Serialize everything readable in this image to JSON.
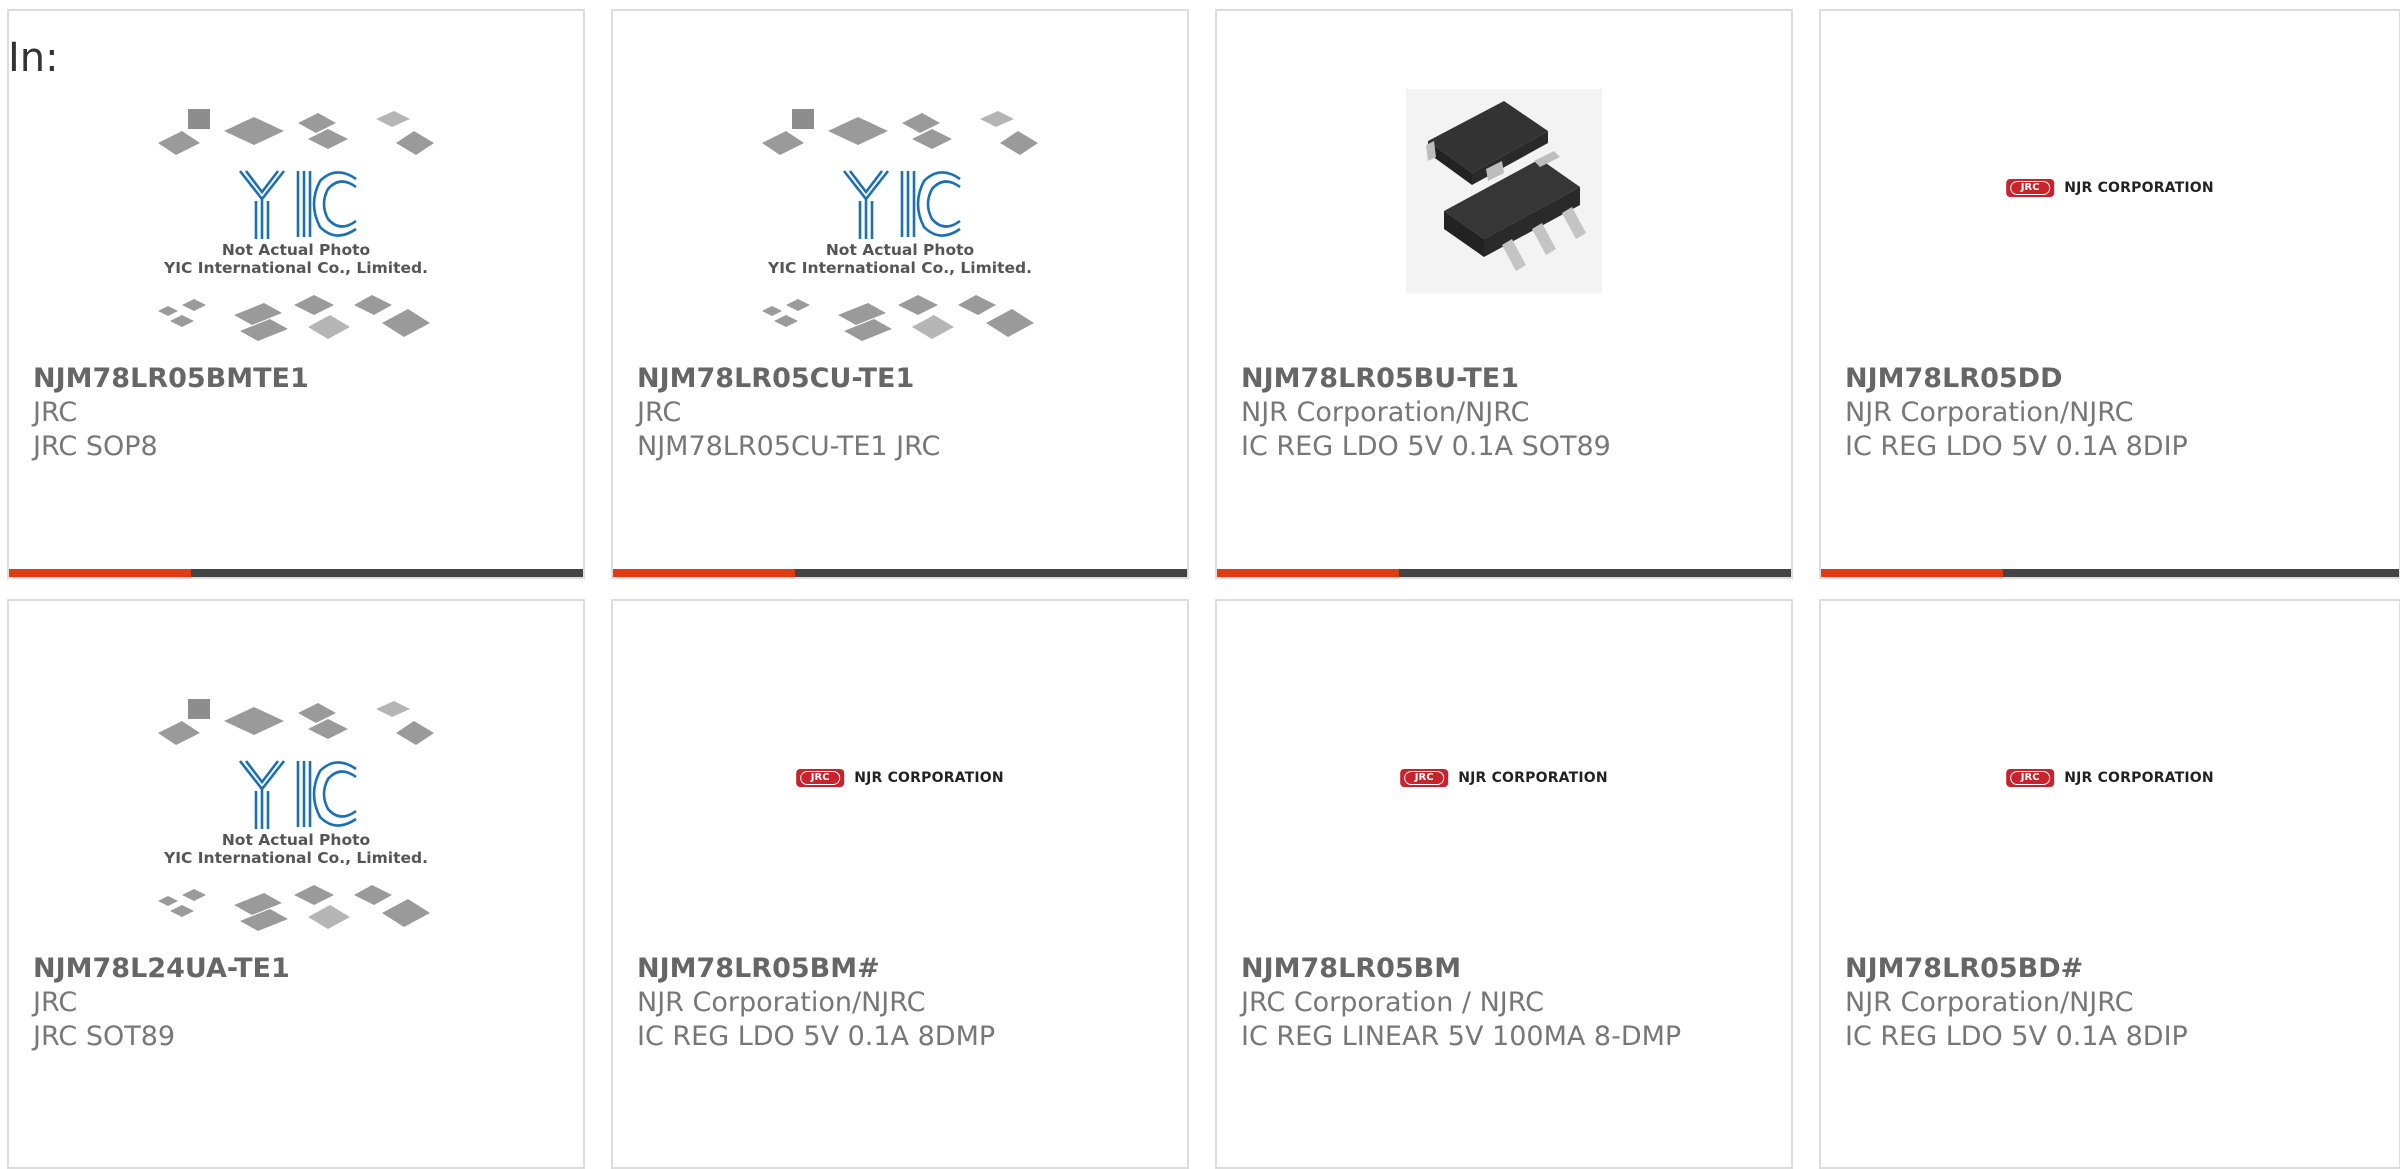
{
  "page": {
    "in_label": "In:"
  },
  "colors": {
    "accent_bar": "#e03c14",
    "dark_bar": "#444444",
    "njr_red": "#c8222d",
    "yic_blue": "#1a6fb5"
  },
  "placeholders": {
    "yic_caption_line1": "Not Actual Photo",
    "yic_caption_line2": "YIC International Co., Limited.",
    "yic_logo_text": "YIC",
    "njr_badge_text": "JRC",
    "njr_logo_text": "NJR CORPORATION"
  },
  "products": [
    {
      "part_number": "NJM78LR05BMTE1",
      "manufacturer": "JRC",
      "description": "JRC SOP8",
      "image": "yic-placeholder"
    },
    {
      "part_number": "NJM78LR05CU-TE1",
      "manufacturer": "JRC",
      "description": "NJM78LR05CU-TE1 JRC",
      "image": "yic-placeholder"
    },
    {
      "part_number": "NJM78LR05BU-TE1",
      "manufacturer": "NJR Corporation/NJRC",
      "description": "IC REG LDO 5V 0.1A SOT89",
      "image": "sot89-photo"
    },
    {
      "part_number": "NJM78LR05DD",
      "manufacturer": "NJR Corporation/NJRC",
      "description": "IC REG LDO 5V 0.1A 8DIP",
      "image": "njr-logo"
    },
    {
      "part_number": "NJM78L24UA-TE1",
      "manufacturer": "JRC",
      "description": "JRC SOT89",
      "image": "yic-placeholder"
    },
    {
      "part_number": "NJM78LR05BM#",
      "manufacturer": "NJR Corporation/NJRC",
      "description": "IC REG LDO 5V 0.1A 8DMP",
      "image": "njr-logo"
    },
    {
      "part_number": "NJM78LR05BM",
      "manufacturer": "JRC Corporation / NJRC",
      "description": "IC REG LINEAR 5V 100MA 8-DMP",
      "image": "njr-logo"
    },
    {
      "part_number": "NJM78LR05BD#",
      "manufacturer": "NJR Corporation/NJRC",
      "description": "IC REG LDO 5V 0.1A 8DIP",
      "image": "njr-logo"
    }
  ]
}
